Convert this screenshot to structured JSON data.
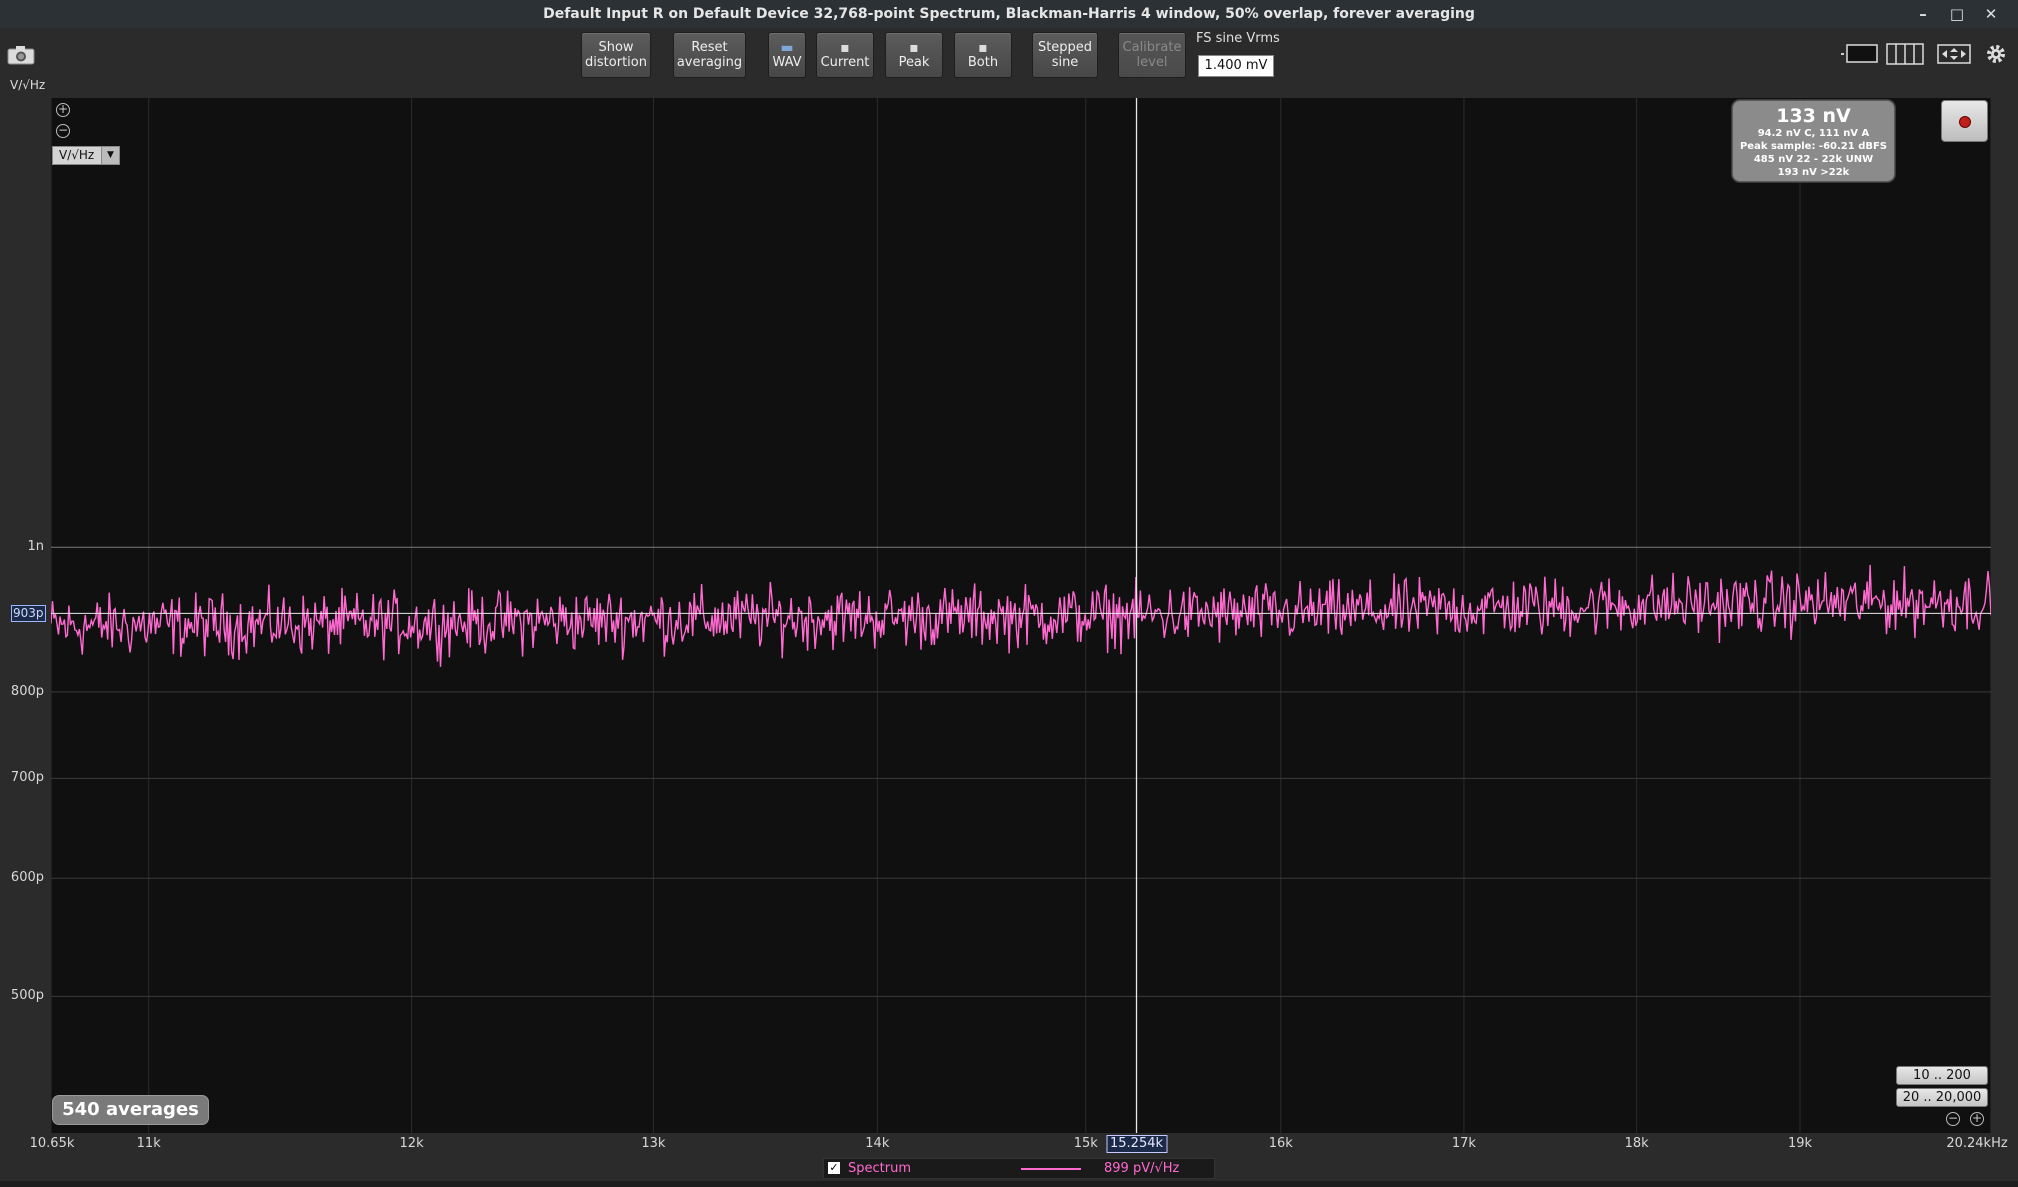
{
  "window": {
    "title": "Default Input R on Default Device 32,768-point Spectrum, Blackman-Harris 4 window, 50% overlap, forever averaging",
    "controls": {
      "minimize": "–",
      "maximize": "□",
      "close": "✕"
    }
  },
  "toolbar": {
    "show_distortion": [
      "Show",
      "distortion"
    ],
    "reset_averaging": [
      "Reset",
      "averaging"
    ],
    "wav": "WAV",
    "current": "Current",
    "peak": "Peak",
    "both": "Both",
    "stepped_sine": [
      "Stepped",
      "sine"
    ],
    "calibrate_level": [
      "Calibrate",
      "level"
    ],
    "fs_sine_label": "FS sine Vrms",
    "fs_sine_value": "1.400 mV"
  },
  "unit_label": "V/√Hz",
  "unit_select": "V/√Hz",
  "stats": {
    "main": "133 nV",
    "line1": "94.2 nV C, 111 nV A",
    "line2": "Peak sample: -60.21 dBFS",
    "line3": "485 nV 22 - 22k UNW",
    "line4": "193 nV >22k"
  },
  "averages": "540 averages",
  "range_buttons": [
    "10 .. 200",
    "20 .. 20,000"
  ],
  "cursor": {
    "x_label": "15.254k",
    "y_label": "903p"
  },
  "legend": {
    "name": "Spectrum",
    "value": "899 pV/√Hz",
    "checked": true
  },
  "colors": {
    "trace": "#ff6ad0",
    "background": "#101010",
    "grid": "#3a3a3a"
  },
  "chart_data": {
    "type": "line",
    "title": "",
    "xlabel": "",
    "ylabel": "V/√Hz",
    "x_scale": "log",
    "y_scale": "log",
    "xlim": [
      10650,
      20240
    ],
    "ylim": [
      4.05e-10,
      2e-09
    ],
    "x_ticks": [
      {
        "value": 10650,
        "label": "10.65k"
      },
      {
        "value": 11000,
        "label": "11k"
      },
      {
        "value": 12000,
        "label": "12k"
      },
      {
        "value": 13000,
        "label": "13k"
      },
      {
        "value": 14000,
        "label": "14k"
      },
      {
        "value": 15000,
        "label": "15k"
      },
      {
        "value": 16000,
        "label": "16k"
      },
      {
        "value": 17000,
        "label": "17k"
      },
      {
        "value": 18000,
        "label": "18k"
      },
      {
        "value": 19000,
        "label": "19k"
      },
      {
        "value": 20240,
        "label": "20.24kHz"
      }
    ],
    "y_ticks": [
      {
        "value": 1e-09,
        "label": "1n"
      },
      {
        "value": 8e-10,
        "label": "800p"
      },
      {
        "value": 7e-10,
        "label": "700p"
      },
      {
        "value": 6e-10,
        "label": "600p"
      },
      {
        "value": 5e-10,
        "label": "500p"
      }
    ],
    "cursor": {
      "x": 15254,
      "y": 9.03e-10
    },
    "series": [
      {
        "name": "Spectrum",
        "x": [
          10650,
          11000,
          12000,
          13000,
          14000,
          15000,
          16000,
          17000,
          18000,
          19000,
          20240
        ],
        "values": [
          8.85e-10,
          8.87e-10,
          8.9e-10,
          8.95e-10,
          8.98e-10,
          9e-10,
          9.03e-10,
          9.1e-10,
          9.15e-10,
          9.18e-10,
          9.2e-10
        ],
        "noise_band": [
          8.35e-10,
          9.75e-10
        ]
      }
    ]
  }
}
